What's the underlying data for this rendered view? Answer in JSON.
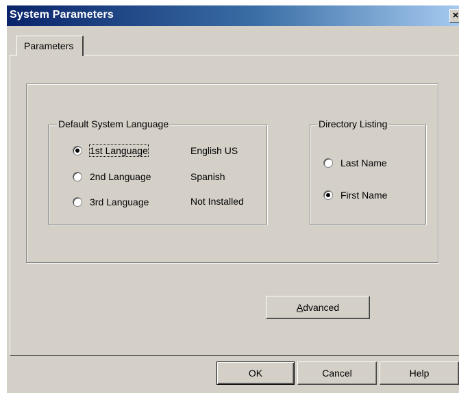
{
  "window": {
    "title": "System Parameters",
    "close_glyph": "×"
  },
  "tabs": [
    {
      "label": "Parameters"
    }
  ],
  "language_group": {
    "legend": "Default System Language",
    "options": [
      {
        "label": "1st Language",
        "value": "English US",
        "checked": true
      },
      {
        "label": "2nd Language",
        "value": "Spanish",
        "checked": false
      },
      {
        "label": "3rd Language",
        "value": "Not Installed",
        "checked": false
      }
    ]
  },
  "directory_group": {
    "legend": "Directory Listing",
    "options": [
      {
        "label": "Last Name",
        "checked": false
      },
      {
        "label": "First Name",
        "checked": true
      }
    ]
  },
  "buttons": {
    "advanced_prefix": "A",
    "advanced_rest": "dvanced",
    "ok": "OK",
    "cancel": "Cancel",
    "help": "Help"
  },
  "colors": {
    "title_start": "#0a246a",
    "title_end": "#a6caf0",
    "face": "#d4d0c8"
  }
}
